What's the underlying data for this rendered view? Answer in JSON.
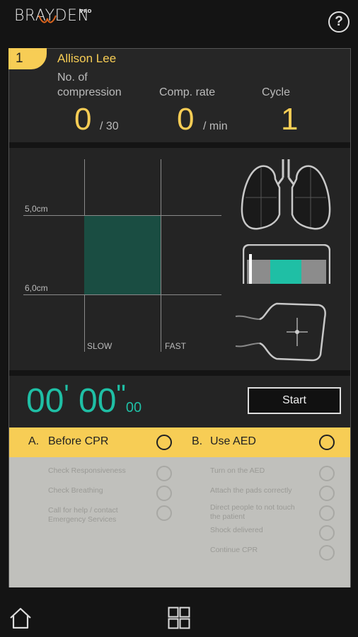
{
  "app": {
    "brand": "BRAYDEN",
    "brand_badge": "PRO",
    "help_label": "?"
  },
  "session": {
    "number": "1",
    "name": "Allison Lee"
  },
  "stats": {
    "compressions_label_line1": "No. of",
    "compressions_label_line2": "compression",
    "compressions_value": "0",
    "compressions_total": "/ 30",
    "rate_label": "Comp. rate",
    "rate_value": "0",
    "rate_unit": "/ min",
    "cycle_label": "Cycle",
    "cycle_value": "1"
  },
  "graph": {
    "depth_top_label": "5,0cm",
    "depth_bottom_label": "6,0cm",
    "slow_label": "SLOW",
    "fast_label": "FAST"
  },
  "timer": {
    "minutes": "00",
    "seconds": "00",
    "hundredths": "00",
    "start_label": "Start"
  },
  "checklists": {
    "before_cpr": {
      "letter": "A.",
      "title": "Before CPR",
      "items": [
        "Check Responsiveness",
        "Check Breathing",
        "Call for help / contact",
        "Emergency Services"
      ]
    },
    "use_aed": {
      "letter": "B.",
      "title": "Use AED",
      "items": [
        "Turn on the AED",
        "Attach the pads correctly",
        "Direct people to not touch",
        "the patient",
        "Shock delivered",
        "Continue CPR"
      ]
    }
  },
  "colors": {
    "accent_yellow": "#f7cd55",
    "accent_teal": "#1fbfa5",
    "zone_green": "#1a4d42",
    "background": "#141414"
  },
  "icons": {
    "lungs": "lungs-icon",
    "pressure_bar": "hand-position-bar-icon",
    "chest": "chest-position-icon",
    "home": "home-icon",
    "menu": "grid-menu-icon"
  }
}
